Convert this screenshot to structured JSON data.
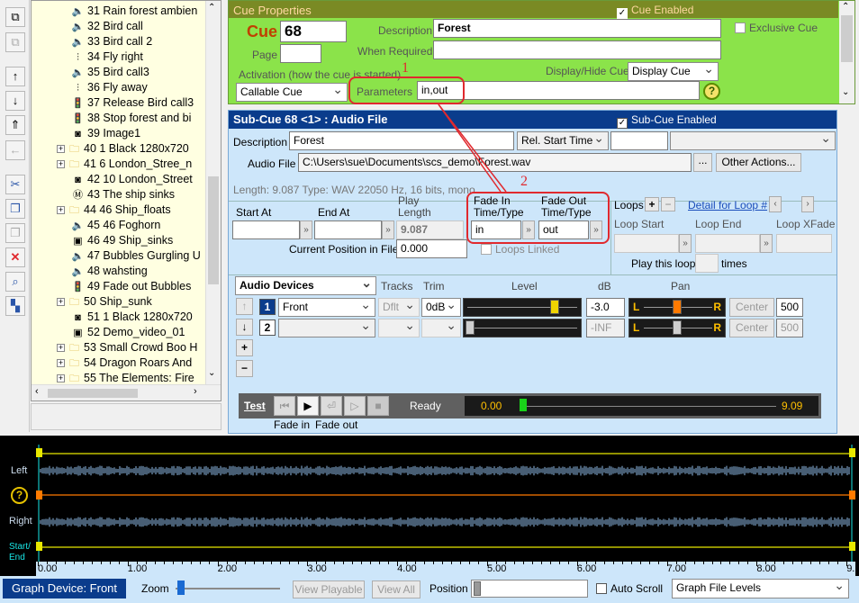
{
  "toolbar": {
    "buttons": [
      "copy-icon",
      "paste-icon",
      "arrow-up-icon",
      "arrow-down-icon",
      "move-up-icon",
      "move-left-icon",
      "cut-icon",
      "copy2-icon",
      "paste2-icon",
      "delete-icon",
      "find-icon",
      "rearrange-icon"
    ]
  },
  "tree": {
    "items": [
      {
        "label": "31 Rain forest ambien",
        "icon": "audio-icon",
        "exp": false
      },
      {
        "label": "32 Bird call",
        "icon": "audio-icon",
        "exp": false
      },
      {
        "label": "33 Bird call 2",
        "icon": "audio-icon",
        "exp": false
      },
      {
        "label": "34 Fly right",
        "icon": "level-icon",
        "exp": false
      },
      {
        "label": "35 Bird call3",
        "icon": "audio-icon",
        "exp": false
      },
      {
        "label": "36 Fly away",
        "icon": "level-icon",
        "exp": false
      },
      {
        "label": "37 Release Bird call3",
        "icon": "trafficlight-icon",
        "exp": false
      },
      {
        "label": "38 Stop forest and bi",
        "icon": "trafficlight-icon",
        "exp": false
      },
      {
        "label": "39 Image1",
        "icon": "camera-icon",
        "exp": false
      },
      {
        "label": "40 1 Black 1280x720",
        "icon": "folder-icon",
        "exp": true
      },
      {
        "label": "41 6 London_Stree_n",
        "icon": "folder-icon",
        "exp": true
      },
      {
        "label": "42 10 London_Street",
        "icon": "camera-icon",
        "exp": false
      },
      {
        "label": "43 The ship sinks",
        "icon": "memo-icon",
        "exp": false
      },
      {
        "label": "44 46 Ship_floats",
        "icon": "folder-icon",
        "exp": true
      },
      {
        "label": "45 46 Foghorn",
        "icon": "audio-icon",
        "exp": false
      },
      {
        "label": "46 49 Ship_sinks",
        "icon": "video-icon",
        "exp": false
      },
      {
        "label": "47 Bubbles Gurgling U",
        "icon": "audio-icon",
        "exp": false
      },
      {
        "label": "48 wahsting",
        "icon": "audio-icon",
        "exp": false
      },
      {
        "label": "49 Fade out Bubbles",
        "icon": "trafficlight-icon",
        "exp": false
      },
      {
        "label": "50 Ship_sunk",
        "icon": "folder-icon",
        "exp": true
      },
      {
        "label": "51 1 Black 1280x720",
        "icon": "camera-icon",
        "exp": false
      },
      {
        "label": "52 Demo_video_01",
        "icon": "video-icon",
        "exp": false
      },
      {
        "label": "53 Small Crowd Boo H",
        "icon": "folder-icon",
        "exp": true
      },
      {
        "label": "54 Dragon Roars And",
        "icon": "folder-icon",
        "exp": true
      },
      {
        "label": "55 The Elements: Fire",
        "icon": "folder-icon",
        "exp": true
      }
    ]
  },
  "cue": {
    "title": "Cue Properties",
    "enabled_label": "Cue Enabled",
    "cue_label": "Cue",
    "cue_number": "68",
    "page_label": "Page",
    "page_value": "",
    "description_label": "Description",
    "description": "Forest",
    "when_required_label": "When Required",
    "when_required": "",
    "exclusive_label": "Exclusive Cue",
    "activation_label": "Activation (how the cue is started)",
    "activation_value": "Callable Cue",
    "display_hide_label": "Display/Hide Cue",
    "display_hide_value": "Display Cue",
    "parameters_label": "Parameters",
    "parameters_value": "in,out",
    "help": "?"
  },
  "subcue": {
    "title": "Sub-Cue 68 <1> : Audio File",
    "enabled_label": "Sub-Cue Enabled",
    "description_label": "Description",
    "description": "Forest",
    "rel_start": "Rel. Start Time",
    "audio_file_label": "Audio File",
    "audio_file": "C:\\Users\\sue\\Documents\\scs_demo\\Forest.wav",
    "ellipsis": "...",
    "other_actions": "Other Actions...",
    "length_info": "Length: 9.087  Type: WAV 22050 Hz, 16 bits, mono",
    "start_at": "Start At",
    "end_at": "End At",
    "play_length": "Play\nLength",
    "play_length_value": "9.087",
    "fade_in_label": "Fade In\nTime/Type",
    "fade_in_value": "in",
    "fade_out_label": "Fade Out\nTime/Type",
    "fade_out_value": "out",
    "current_pos_label": "Current Position in File",
    "current_pos": "0.000",
    "loops_linked": "Loops Linked",
    "loops_label": "Loops",
    "plus": "+",
    "minus": "−",
    "detail_loop": "Detail for Loop #",
    "loop_start": "Loop Start",
    "loop_end": "Loop End",
    "loop_xfade": "Loop XFade",
    "play_this_loop": "Play this loop",
    "times": "times"
  },
  "devices": {
    "header": "Audio Devices",
    "tracks": "Tracks",
    "trim": "Trim",
    "level": "Level",
    "db": "dB",
    "pan": "Pan",
    "rows": [
      {
        "num": "1",
        "device": "Front",
        "tracks": "Dflt",
        "trim": "0dB",
        "db": "-3.0",
        "pan": "Center",
        "pan_value": "500",
        "level": 0.78,
        "pan_pos": 0.5
      },
      {
        "num": "2",
        "device": "",
        "tracks": "",
        "trim": "",
        "db": "-INF",
        "pan": "Center",
        "pan_value": "500",
        "level": 0.0,
        "pan_pos": 0.5
      }
    ],
    "L": "L",
    "R": "R"
  },
  "transport": {
    "test": "Test",
    "status": "Ready",
    "pos_start": "0.00",
    "pos_end": "9.09",
    "fade_in": "Fade in",
    "fade_out": "Fade out"
  },
  "annotations": {
    "one": "1",
    "two": "2"
  },
  "graph": {
    "left": "Left",
    "right": "Right",
    "start_end": "Start/\nEnd",
    "help": "?",
    "axis": [
      "0.00",
      "1.00",
      "2.00",
      "3.00",
      "4.00",
      "5.00",
      "6.00",
      "7.00",
      "8.00",
      "9."
    ]
  },
  "bottom": {
    "graph_device": "Graph Device: Front",
    "zoom": "Zoom",
    "view_playable": "View Playable",
    "view_all": "View All",
    "position": "Position",
    "auto_scroll": "Auto Scroll",
    "graph_levels": "Graph File Levels"
  },
  "colors": {
    "green": "#8be34a",
    "olive": "#7a8a24",
    "blue": "#0a3c8c",
    "light_blue": "#cde6fa",
    "accent_red": "#e0292e"
  }
}
